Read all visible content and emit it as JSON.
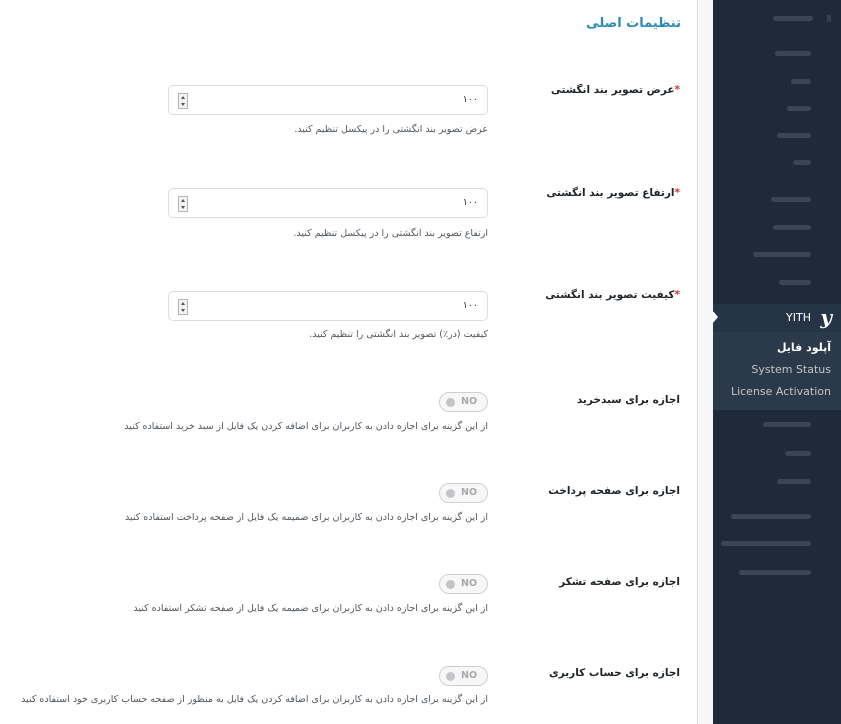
{
  "section_title": "تنظیمات اصلی",
  "fields": {
    "width": {
      "label": "عرض تصویر بند انگشتی",
      "required_mark": "*",
      "value": "۱۰۰",
      "description": "عرض تصویر بند انگشتی را در پیکسل تنظیم کنید."
    },
    "height": {
      "label": "ارتفاع تصویر بند انگشتی",
      "required_mark": "*",
      "value": "۱۰۰",
      "description": "ارتفاع تصویر بند انگشتی را در پیکسل تنظیم کنید."
    },
    "quality": {
      "label": "کیفیت تصویر بند انگشتی",
      "required_mark": "*",
      "value": "۱۰۰",
      "description": "کیفیت (در٪) تصویر بند انگشتی را تنظیم کنید."
    }
  },
  "toggles": {
    "cart": {
      "label": "اجازه برای سبدخرید",
      "state": "NO",
      "description": "از این گزینه برای اجازه دادن به کاربران برای اضافه کردن یک فایل از سبد خرید استفاده کنید"
    },
    "checkout": {
      "label": "اجازه برای صفحه پرداخت",
      "state": "NO",
      "description": "از این گزینه برای اجازه دادن به کاربران برای ضمیمه یک فایل از صفحه پرداخت استفاده کنید"
    },
    "thankyou": {
      "label": "اجازه برای صفحه تشکر",
      "state": "NO",
      "description": "از این گزینه برای اجازه دادن به کاربران برای ضمیمه یک فایل از صفحه تشکر استفاده کنید"
    },
    "account": {
      "label": "اجازه برای حساب کاربری",
      "state": "NO",
      "description": "از این گزینه برای اجازه دادن به کاربران برای اضافه کردن یک فایل به منظور از صفحه حساب کاربری خود استفاده کنید"
    }
  },
  "sidebar": {
    "yith_label": "YITH",
    "yith_icon": "y",
    "submenu": {
      "upload": "آپلود فایل",
      "status": "System Status",
      "license": "License Activation"
    }
  },
  "colors": {
    "title_accent": "#2b8bb6",
    "required": "#d63638",
    "sidebar_bg": "#1f2a38"
  }
}
